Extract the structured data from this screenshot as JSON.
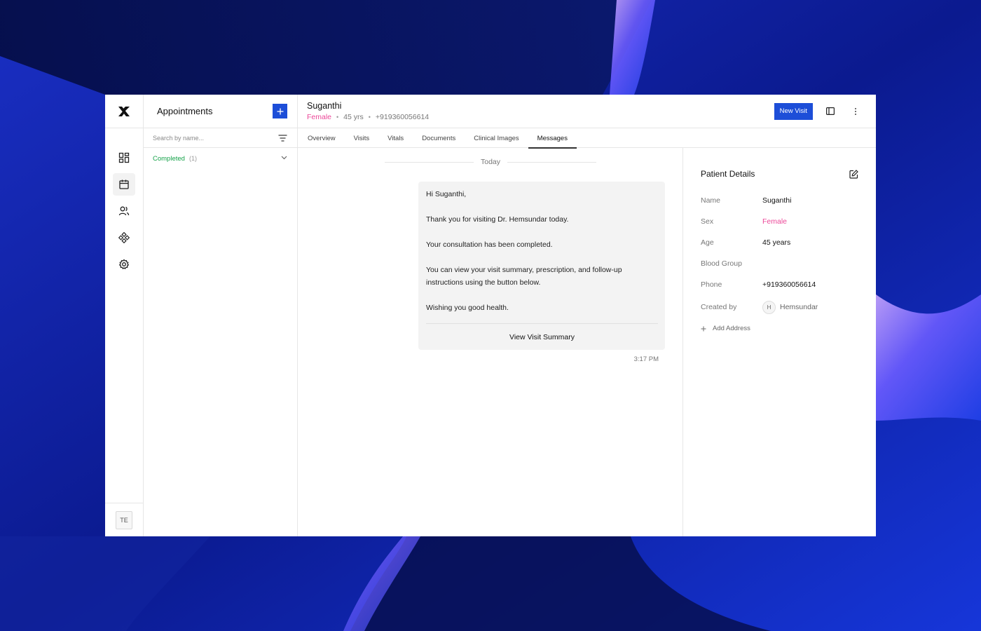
{
  "colors": {
    "accent": "#1d4ed8",
    "success": "#16a34a",
    "pink": "#ec4899"
  },
  "sidebar": {
    "logo_icon": "x-logo-icon",
    "items": [
      {
        "name": "dashboard-icon",
        "active": false
      },
      {
        "name": "calendar-icon",
        "active": true
      },
      {
        "name": "users-icon",
        "active": false
      },
      {
        "name": "integrations-icon",
        "active": false
      },
      {
        "name": "settings-icon",
        "active": false
      }
    ],
    "user_initials": "TE"
  },
  "appointments": {
    "title": "Appointments",
    "add_icon": "plus-icon",
    "search_placeholder": "Search by name...",
    "filter_icon": "filter-icon",
    "groups": [
      {
        "label": "Completed",
        "count": "(1)",
        "icon": "chevron-down-icon"
      }
    ]
  },
  "patient": {
    "name": "Suganthi",
    "sex": "Female",
    "age": "45 yrs",
    "phone": "+919360056614",
    "separator": "•",
    "new_visit_label": "New Visit",
    "panel_icon": "sidebar-panel-icon",
    "more_icon": "more-vertical-icon"
  },
  "tabs": [
    {
      "label": "Overview",
      "active": false
    },
    {
      "label": "Visits",
      "active": false
    },
    {
      "label": "Vitals",
      "active": false
    },
    {
      "label": "Documents",
      "active": false
    },
    {
      "label": "Clinical Images",
      "active": false
    },
    {
      "label": "Messages",
      "active": true
    }
  ],
  "messages": {
    "day_label": "Today",
    "bubble": {
      "paragraphs": [
        "Hi Suganthi,",
        "Thank you for visiting Dr. Hemsundar today.",
        "Your consultation has been completed.",
        "You can view your visit summary, prescription, and follow-up instructions using the button below.",
        "Wishing you good health."
      ],
      "button_label": "View Visit Summary",
      "time": "3:17 PM"
    }
  },
  "details": {
    "title": "Patient Details",
    "edit_icon": "edit-icon",
    "rows": [
      {
        "label": "Name",
        "value": "Suganthi"
      },
      {
        "label": "Sex",
        "value": "Female"
      },
      {
        "label": "Age",
        "value": "45 years"
      },
      {
        "label": "Blood Group",
        "value": ""
      },
      {
        "label": "Phone",
        "value": "+919360056614"
      }
    ],
    "created_by_label": "Created by",
    "created_by_initial": "H",
    "created_by_name": "Hemsundar",
    "add_address_label": "Add Address"
  }
}
